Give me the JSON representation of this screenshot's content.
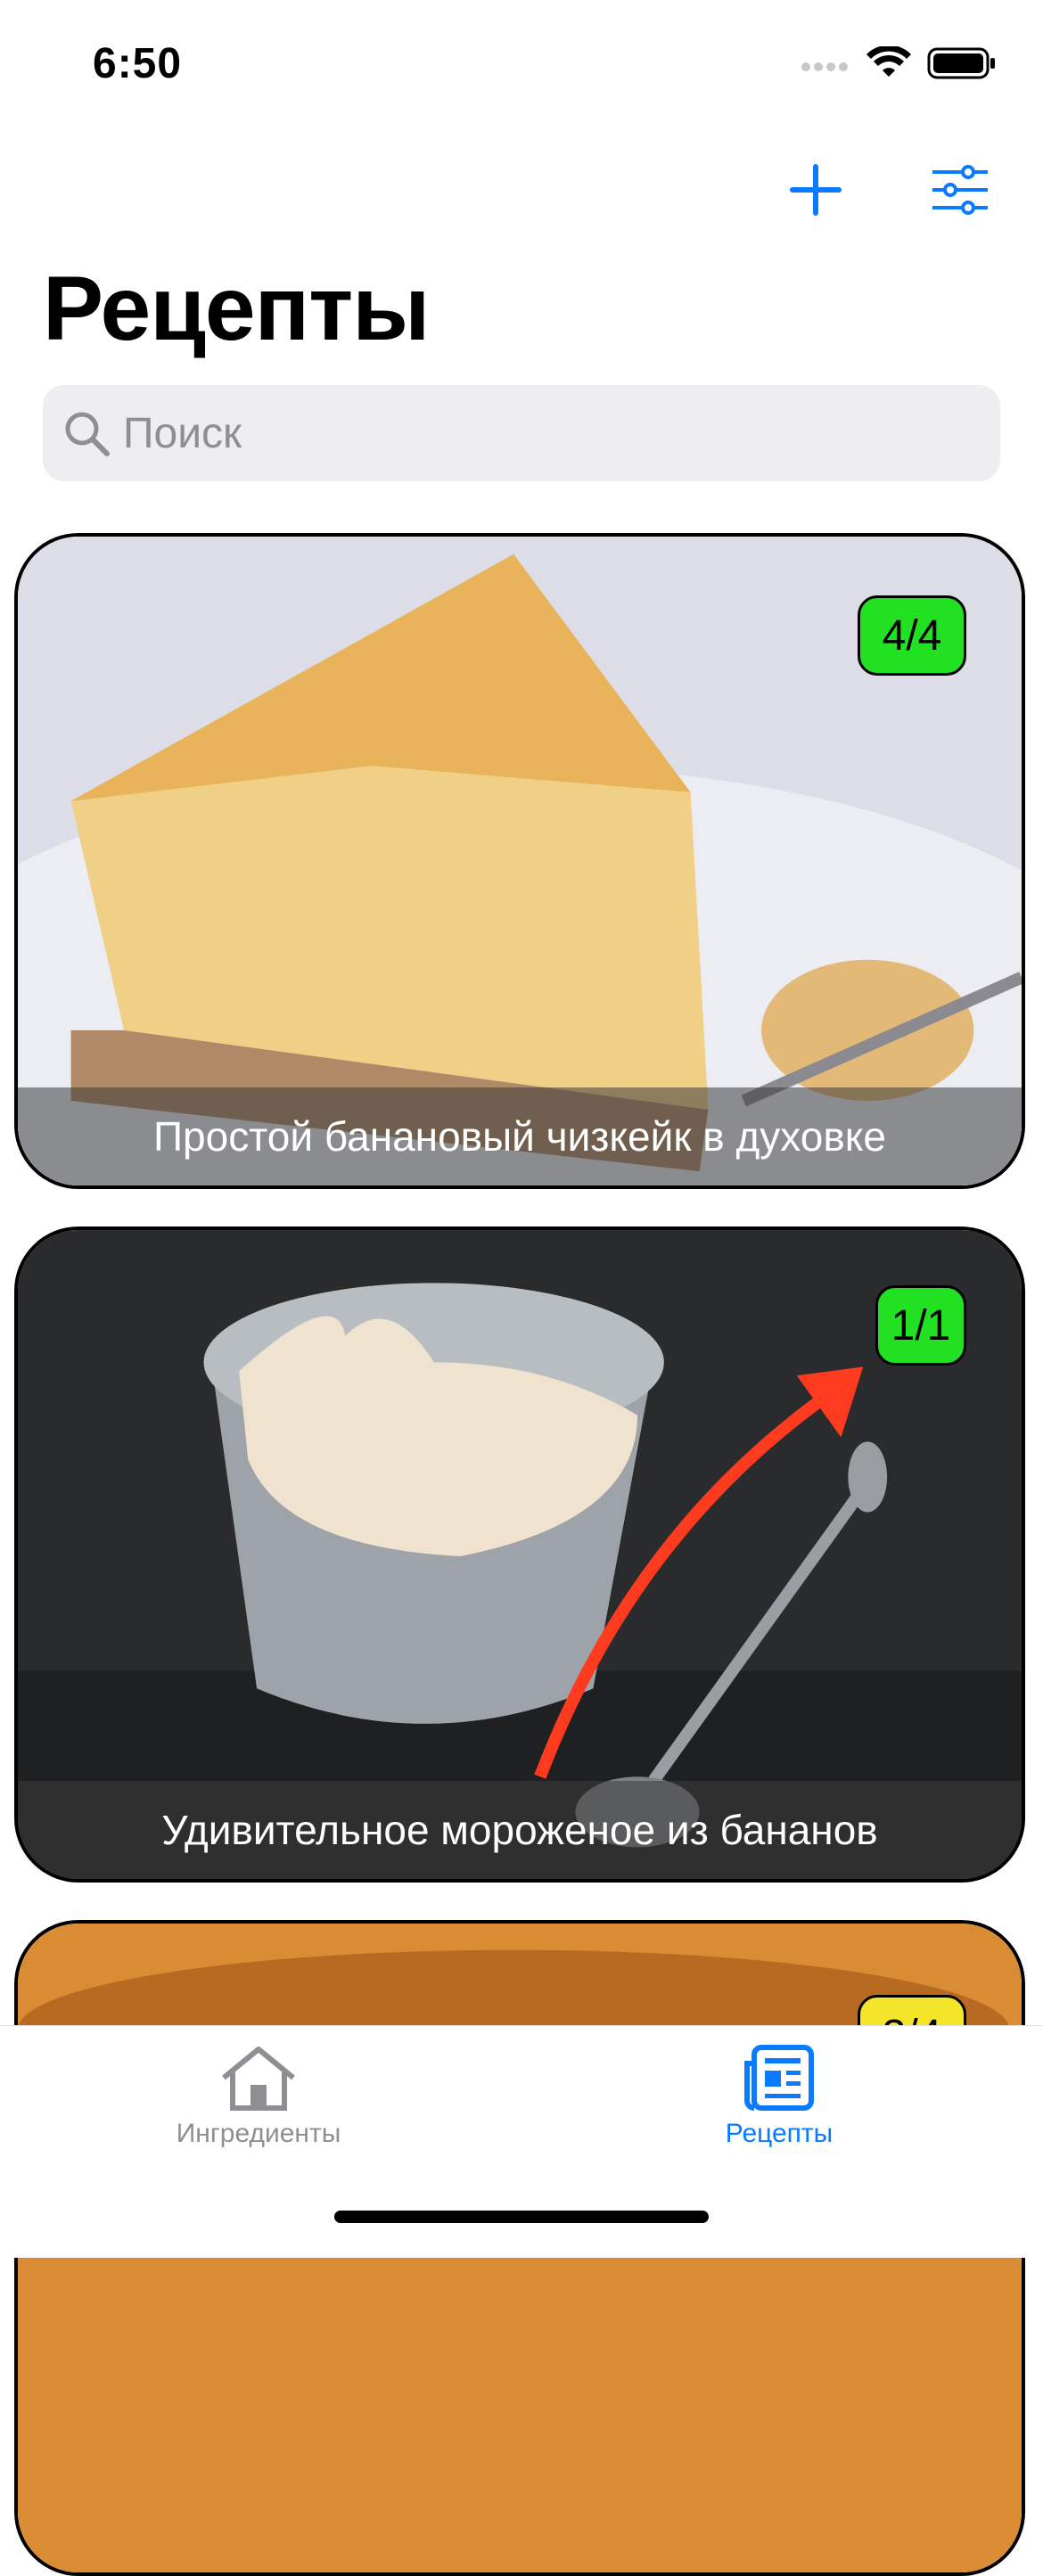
{
  "status_bar": {
    "time": "6:50"
  },
  "header": {
    "title": "Рецепты"
  },
  "search": {
    "placeholder": "Поиск",
    "value": ""
  },
  "recipes": [
    {
      "title": "Простой банановый чизкейк в духовке",
      "badge": "4/4",
      "badge_color": "#22e022"
    },
    {
      "title": "Удивительное мороженое из бананов",
      "badge": "1/1",
      "badge_color": "#22e022"
    },
    {
      "title": "",
      "badge": "3/4",
      "badge_color": "#f5e52a"
    }
  ],
  "tabs": [
    {
      "label": "Ингредиенты",
      "icon": "house-icon",
      "active": false
    },
    {
      "label": "Рецепты",
      "icon": "newspaper-icon",
      "active": true
    }
  ],
  "colors": {
    "accent": "#0a7aff",
    "inactive": "#8e8e93"
  }
}
